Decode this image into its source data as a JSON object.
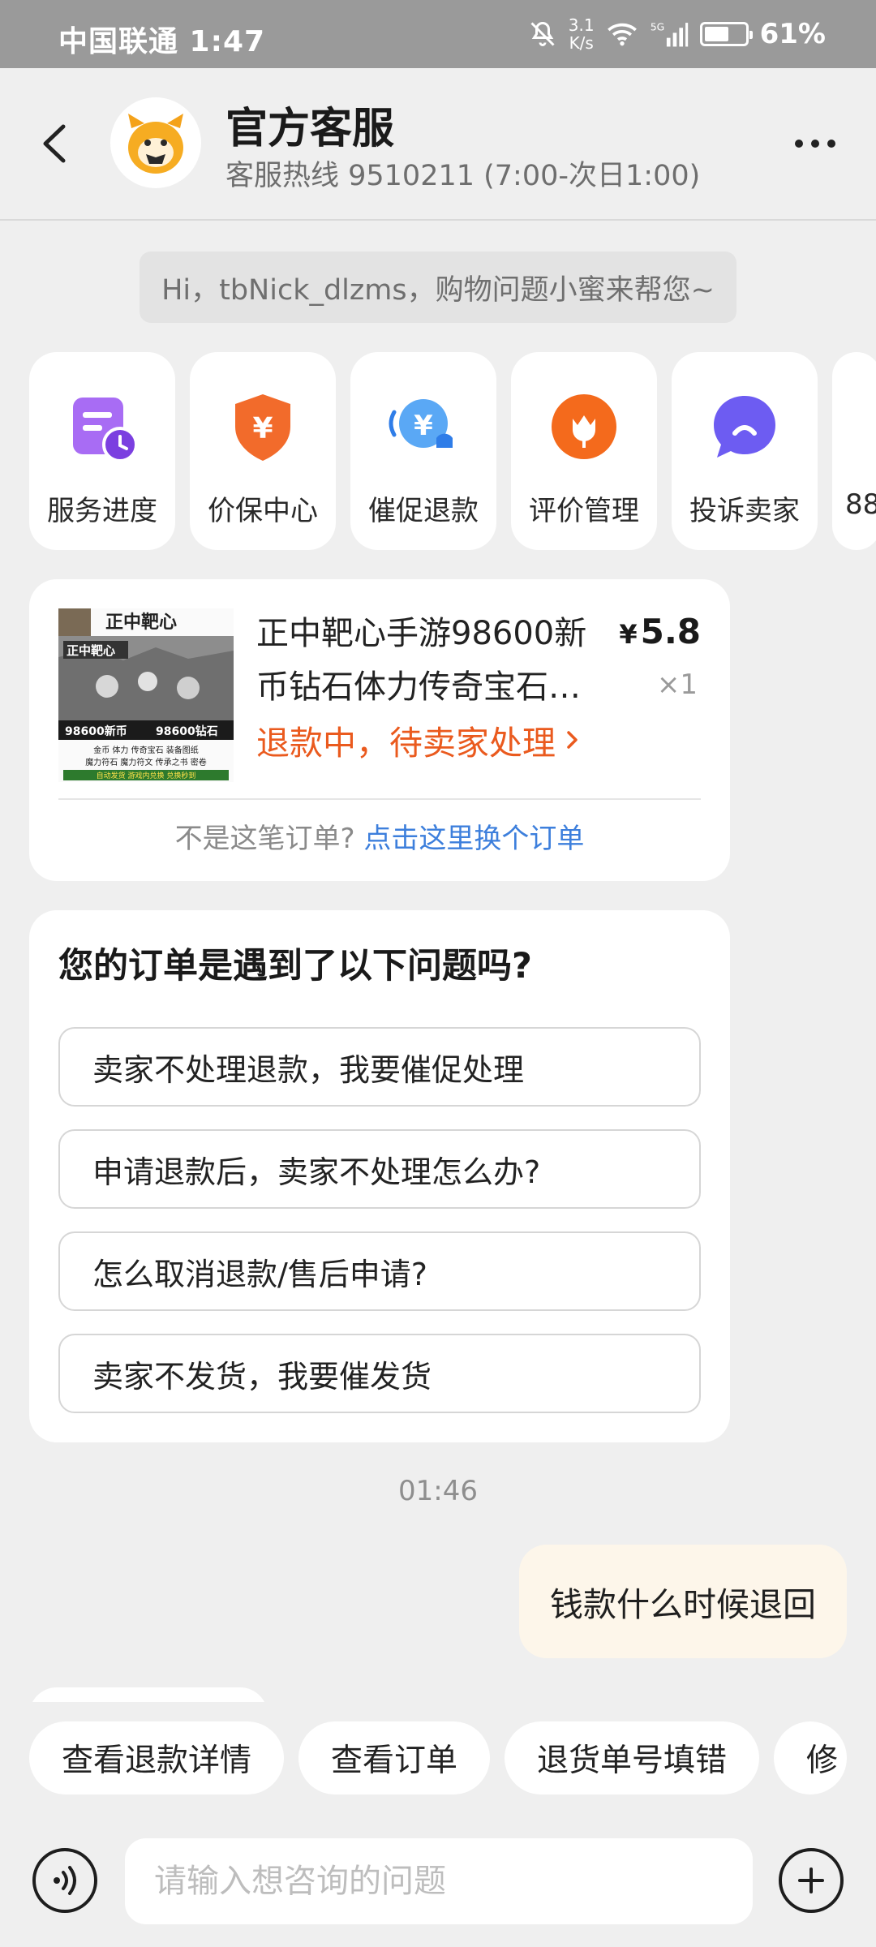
{
  "status_bar": {
    "carrier_time": "中国联通 1:47",
    "speed_value": "3.1",
    "speed_unit": "K/s",
    "network": "5G",
    "battery": "61%",
    "battery_level": 0.61
  },
  "header": {
    "title": "官方客服",
    "subtitle": "客服热线 9510211 (7:00-次日1:00)"
  },
  "greeting": "Hi，tbNick_dlzms，购物问题小蜜来帮您~",
  "services": [
    {
      "label": "服务进度",
      "icon": "service-progress-icon",
      "color": "#9b5cf0"
    },
    {
      "label": "价保中心",
      "icon": "price-protect-icon",
      "color": "#f06a2a"
    },
    {
      "label": "催促退款",
      "icon": "refund-bell-icon",
      "color": "#3d8ef0"
    },
    {
      "label": "评价管理",
      "icon": "tulip-icon",
      "color": "#f26a1f"
    },
    {
      "label": "投诉卖家",
      "icon": "complaint-chat-icon",
      "color": "#6b5af0"
    },
    {
      "label": "88"
    }
  ],
  "order": {
    "image_texts": {
      "brand": "正中靶心",
      "logo": "正中靶心",
      "left_amount": "98600新币",
      "right_amount": "98600钻石",
      "line1": "金币 体力 传奇宝石 装备图纸",
      "line2": "魔力符石 魔力符文 传承之书 密卷",
      "line3": "自动发货 游戏内兑换 兑换秒到"
    },
    "name_line1": "正中靶心手游98600新",
    "name_line2": "币钻石体力传奇宝石…",
    "currency": "¥",
    "price": "5.8",
    "qty": "×1",
    "status": "退款中，待卖家处理",
    "change_prefix": "不是这笔订单?",
    "change_link": "点击这里换个订单"
  },
  "questions": {
    "title": "您的订单是遇到了以下问题吗?",
    "options": [
      "卖家不处理退款，我要催促处理",
      "申请退款后，卖家不处理怎么办?",
      "怎么取消退款/售后申请?",
      "卖家不发货，我要催发货"
    ]
  },
  "timestamp": "01:46",
  "user_message": "钱款什么时候退回",
  "quick_actions": [
    "查看退款详情",
    "查看订单",
    "退货单号填错",
    "修"
  ],
  "input": {
    "placeholder": "请输入想咨询的问题"
  }
}
